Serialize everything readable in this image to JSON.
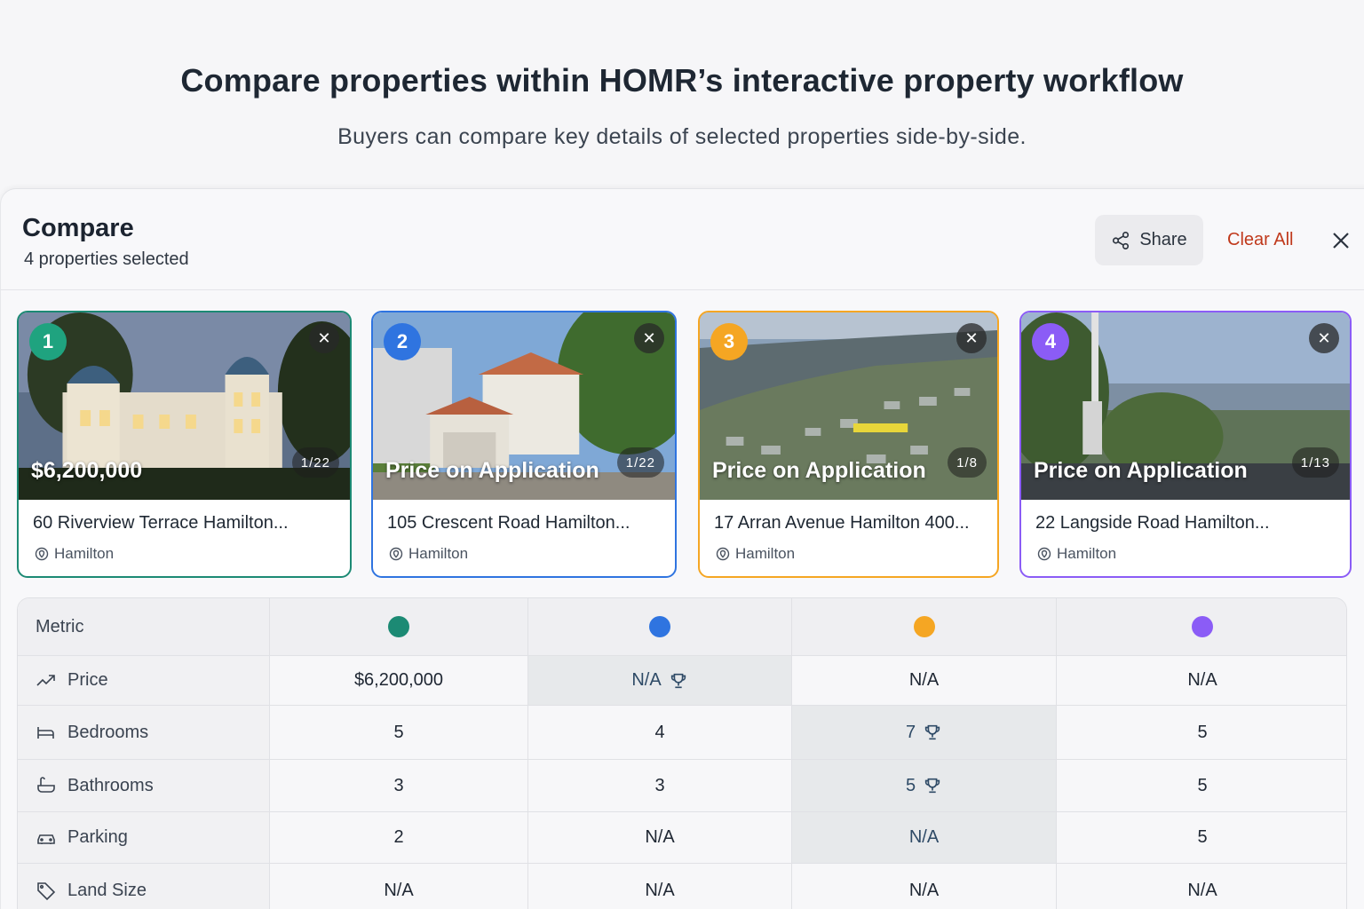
{
  "hero": {
    "title": "Compare properties within HOMR’s interactive property workflow",
    "subtitle": "Buyers can compare key details of selected properties side-by-side."
  },
  "panel": {
    "title": "Compare",
    "subtitle": "4 properties selected",
    "share_label": "Share",
    "clear_label": "Clear All"
  },
  "properties": [
    {
      "number": "1",
      "price": "$6,200,000",
      "photo_count": "1/22",
      "address": "60 Riverview Terrace Hamilton...",
      "suburb": "Hamilton",
      "color": "#1c8a74"
    },
    {
      "number": "2",
      "price": "Price on Application",
      "photo_count": "1/22",
      "address": "105 Crescent Road Hamilton...",
      "suburb": "Hamilton",
      "color": "#2f74e0"
    },
    {
      "number": "3",
      "price": "Price on Application",
      "photo_count": "1/8",
      "address": "17 Arran Avenue Hamilton 400...",
      "suburb": "Hamilton",
      "color": "#f5a623"
    },
    {
      "number": "4",
      "price": "Price on Application",
      "photo_count": "1/13",
      "address": "22 Langside Road Hamilton...",
      "suburb": "Hamilton",
      "color": "#8b5cf6"
    }
  ],
  "table": {
    "metric_header": "Metric",
    "rows": [
      {
        "label": "Price",
        "icon": "trend-up-icon",
        "values": [
          "$6,200,000",
          "N/A",
          "N/A",
          "N/A"
        ],
        "winner": 1
      },
      {
        "label": "Bedrooms",
        "icon": "bed-icon",
        "values": [
          "5",
          "4",
          "7",
          "5"
        ],
        "winner": 2
      },
      {
        "label": "Bathrooms",
        "icon": "bath-icon",
        "values": [
          "3",
          "3",
          "5",
          "5"
        ],
        "winner": 2
      },
      {
        "label": "Parking",
        "icon": "car-icon",
        "values": [
          "2",
          "N/A",
          "N/A",
          "5"
        ],
        "winner": 2,
        "winner_no_trophy": true
      },
      {
        "label": "Land Size",
        "icon": "tag-icon",
        "values": [
          "N/A",
          "N/A",
          "N/A",
          "N/A"
        ],
        "winner": -1
      }
    ]
  }
}
